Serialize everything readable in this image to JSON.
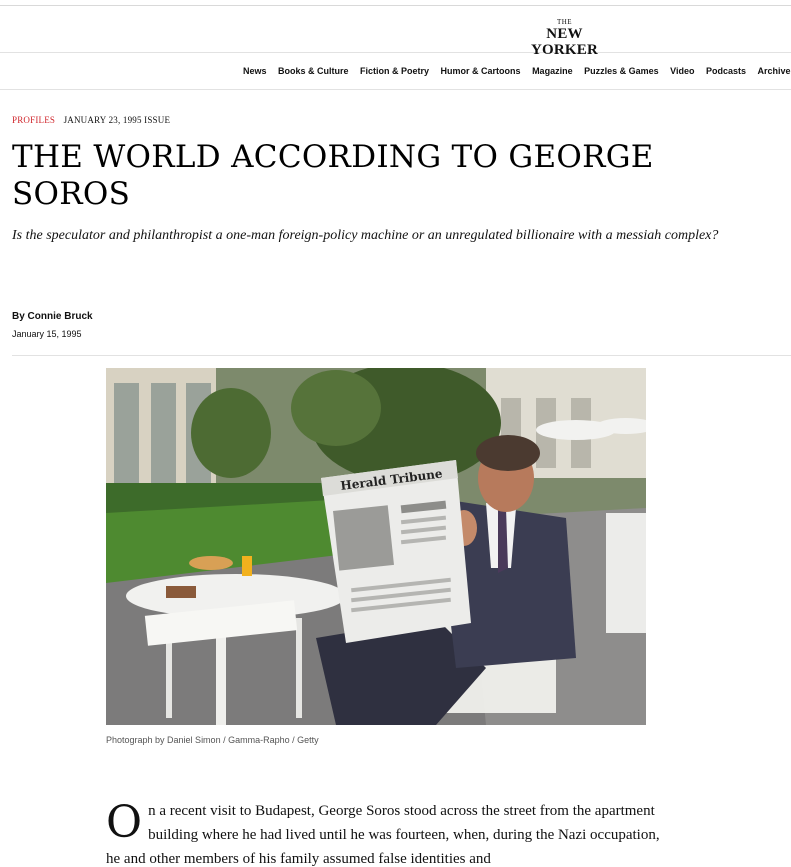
{
  "masthead": {
    "logo_the": "THE",
    "logo_name": "NEW YORKER"
  },
  "nav": {
    "items": [
      "News",
      "Books & Culture",
      "Fiction & Poetry",
      "Humor & Cartoons",
      "Magazine",
      "Puzzles & Games",
      "Video",
      "Podcasts",
      "Archive"
    ]
  },
  "article": {
    "section": "Profiles",
    "issue": "January 23, 1995 Issue",
    "headline": "The World According to George Soros",
    "dek": "Is the speculator and philanthropist a one-man foreign-policy machine or an unregulated billionaire with a messiah complex?",
    "byline": "By Connie Bruck",
    "date": "January 15, 1995",
    "photo_caption": "Photograph by Daniel Simon / Gamma-Rapho / Getty",
    "newspaper_masthead": "Herald Tribune",
    "dropcap": "O",
    "body_first": "n a recent visit to Budapest, George Soros stood across the street from the apartment building where he had lived until he was fourteen, when, during the Nazi occupation, he and other members of his family assumed false identities and"
  },
  "colors": {
    "section_accent": "#d0272d",
    "rule": "#e2e2e2"
  }
}
